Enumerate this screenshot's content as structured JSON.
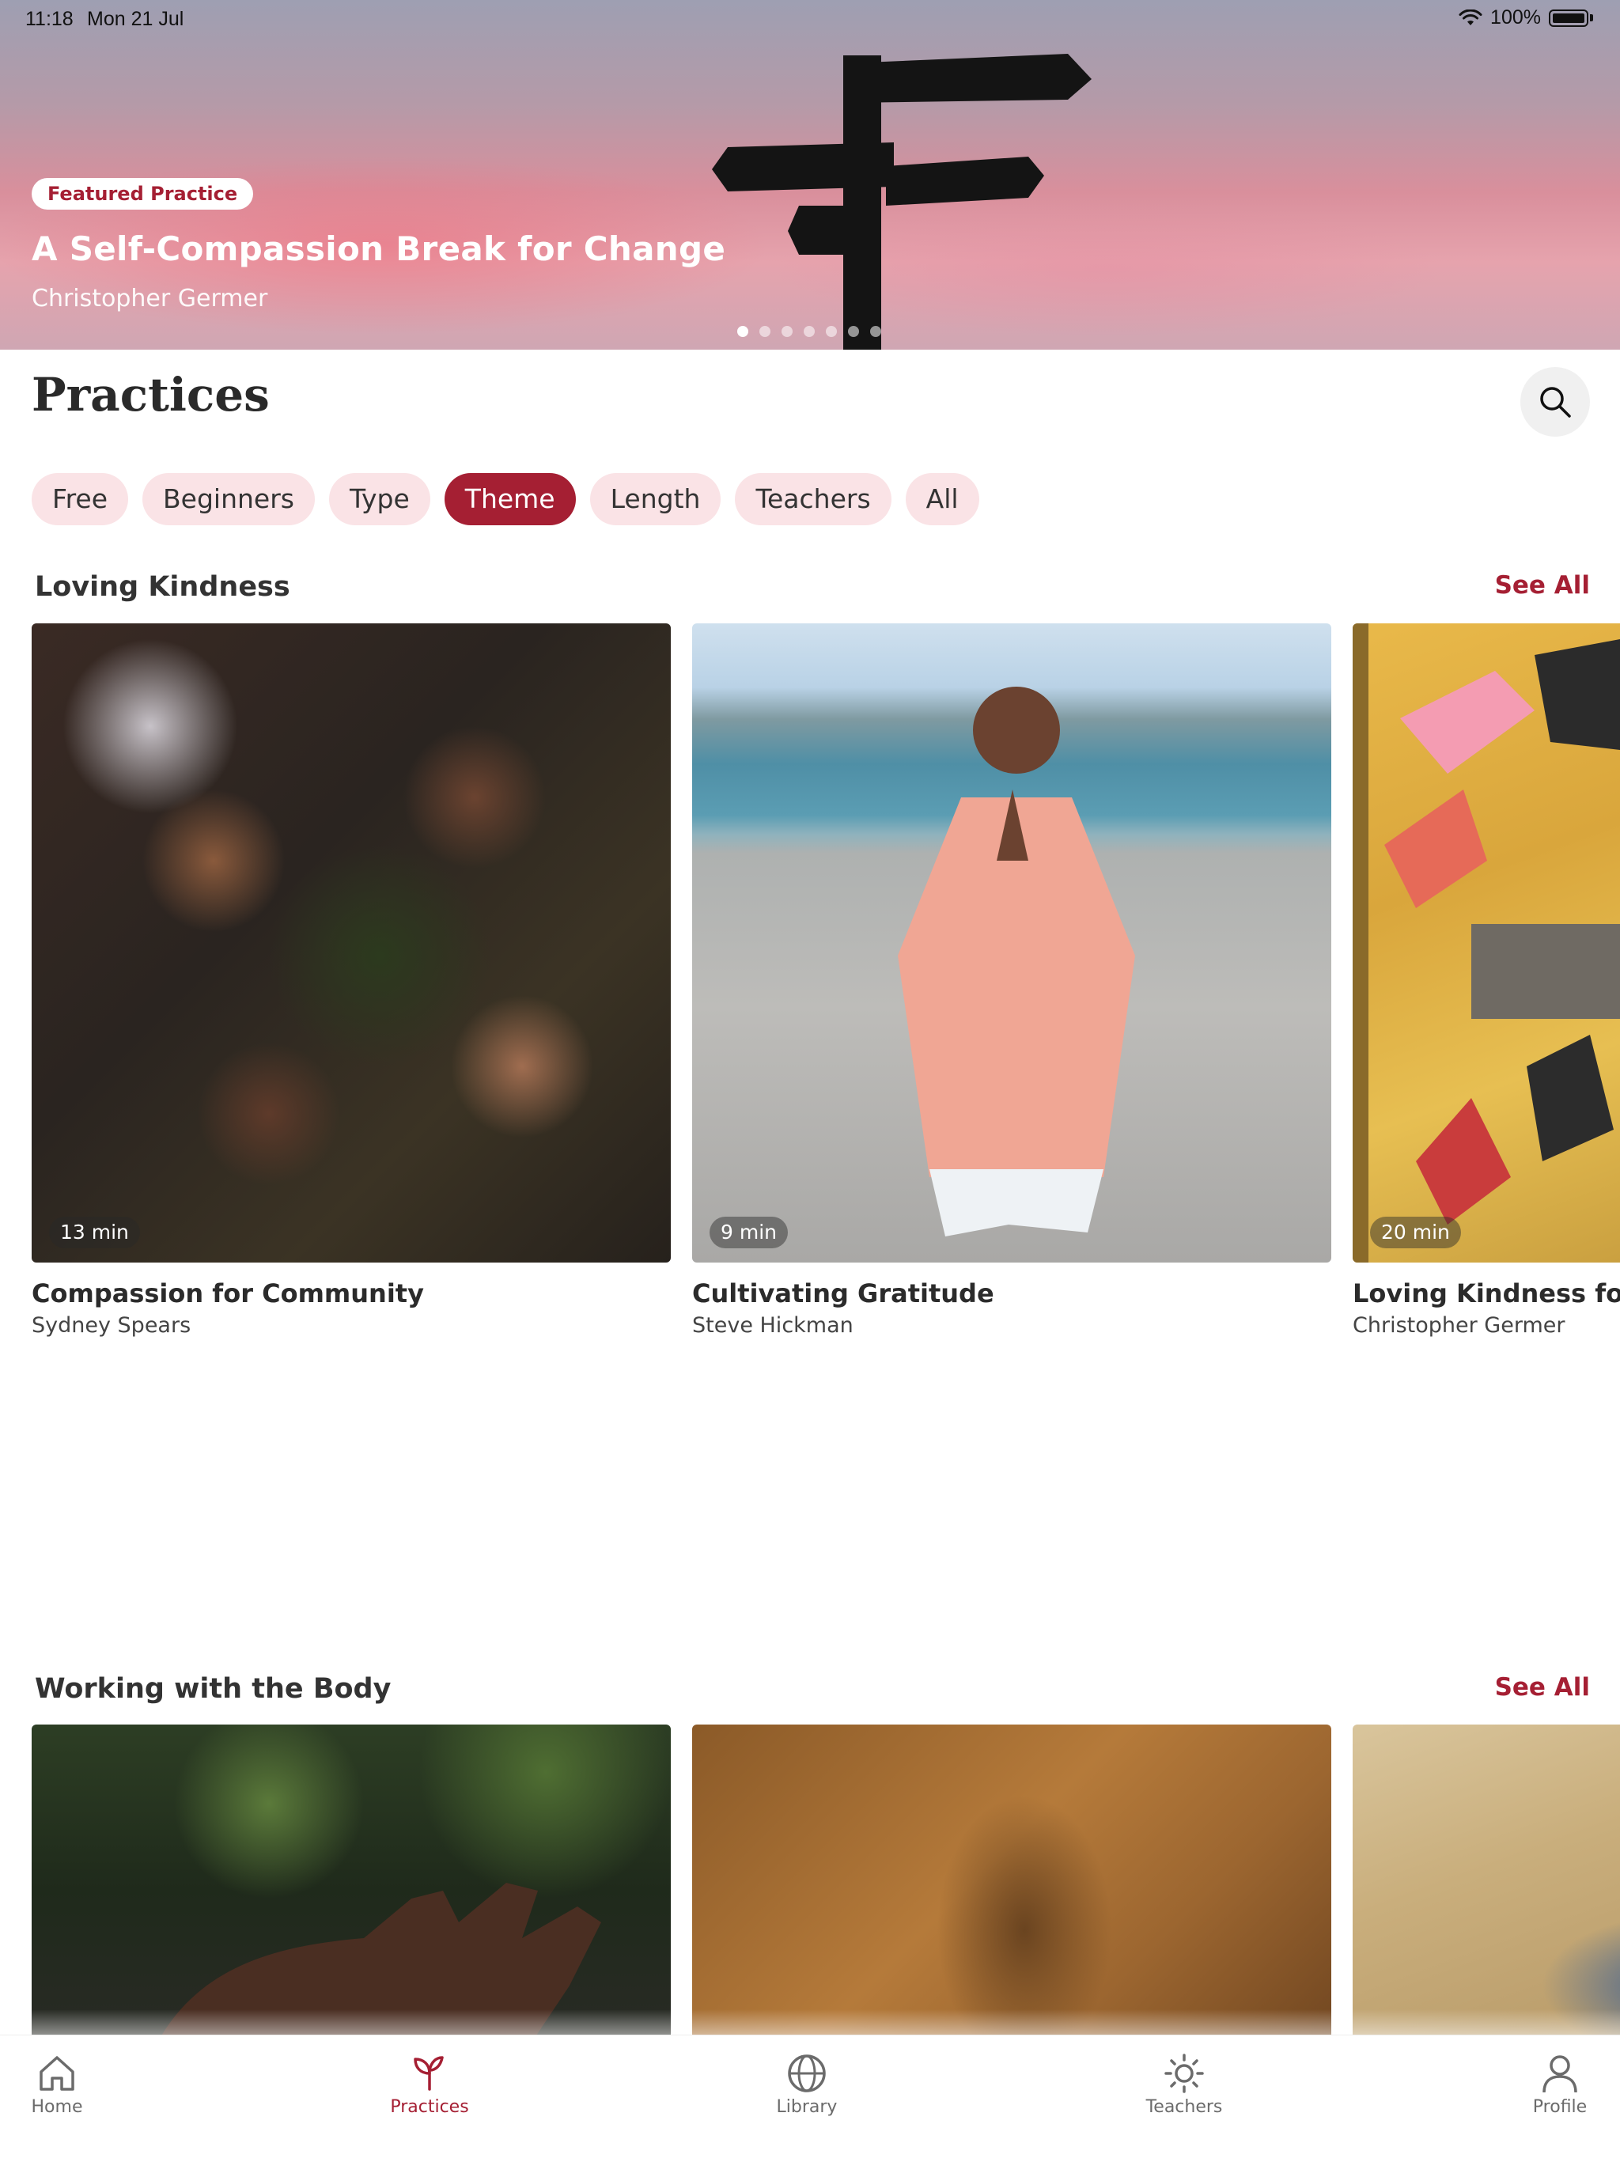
{
  "status_bar": {
    "time": "11:18",
    "date": "Mon 21 Jul",
    "battery": "100%"
  },
  "hero": {
    "badge": "Featured Practice",
    "title": "A Self-Compassion Break for Change",
    "author": "Christopher Germer",
    "page_count": 7,
    "active_page": 1
  },
  "header": {
    "title": "Practices"
  },
  "filters": [
    {
      "label": "Free",
      "active": false
    },
    {
      "label": "Beginners",
      "active": false
    },
    {
      "label": "Type",
      "active": false
    },
    {
      "label": "Theme",
      "active": true
    },
    {
      "label": "Length",
      "active": false
    },
    {
      "label": "Teachers",
      "active": false
    },
    {
      "label": "All",
      "active": false
    }
  ],
  "sections": [
    {
      "title": "Loving Kindness",
      "see_all": "See All",
      "cards": [
        {
          "duration": "13 min",
          "title": "Compassion for Community",
          "author": "Sydney Spears"
        },
        {
          "duration": "9 min",
          "title": "Cultivating Gratitude",
          "author": "Steve Hickman"
        },
        {
          "duration": "20 min",
          "title": "Loving Kindness for Be",
          "author": "Christopher Germer"
        }
      ]
    },
    {
      "title": "Working with the Body",
      "see_all": "See All"
    }
  ],
  "tabbar": {
    "items": [
      {
        "label": "Home",
        "icon": "home-icon"
      },
      {
        "label": "Practices",
        "icon": "sprout-icon",
        "active": true
      },
      {
        "label": "Library",
        "icon": "globe-icon"
      },
      {
        "label": "Teachers",
        "icon": "sun-icon"
      },
      {
        "label": "Profile",
        "icon": "person-icon"
      }
    ]
  },
  "colors": {
    "accent": "#a51f33",
    "chip_bg": "#fae3e6"
  }
}
